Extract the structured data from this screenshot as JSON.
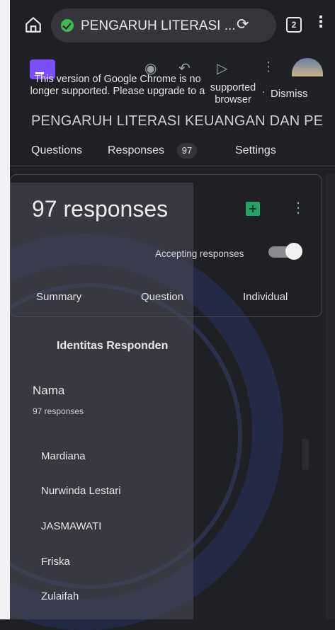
{
  "browser": {
    "url_text": "PENGARUH LITERASI ...",
    "tab_count": "2",
    "icons": {
      "home": "home-icon",
      "secure": "shield-check-icon",
      "reload": "reload-icon",
      "menu": "more-vertical-icon"
    }
  },
  "banner": {
    "message": "This version of Google Chrome is no longer supported. Please upgrade to a",
    "link": "supported browser",
    "separator": ".",
    "dismiss": "Dismiss"
  },
  "form": {
    "title": "PENGARUH LITERASI KEUANGAN DAN PE"
  },
  "tabs": [
    {
      "label": "Questions"
    },
    {
      "label": "Responses",
      "badge": "97"
    },
    {
      "label": "Settings"
    }
  ],
  "card": {
    "count_text": "97 responses",
    "accepting_label": "Accepting responses",
    "accepting_on": true,
    "subtabs": [
      "Summary",
      "Question",
      "Individual"
    ]
  },
  "section": {
    "title": "Identitas Responden"
  },
  "question": {
    "title": "Nama",
    "count_text": "97 responses",
    "answers": [
      "Mardiana",
      "Nurwinda Lestari",
      "JASMAWATI",
      "Friska",
      "Zulaifah"
    ]
  },
  "colors": {
    "background": "#1f2024",
    "accent_green": "#1fa463",
    "forms_purple": "#7c4dff"
  }
}
